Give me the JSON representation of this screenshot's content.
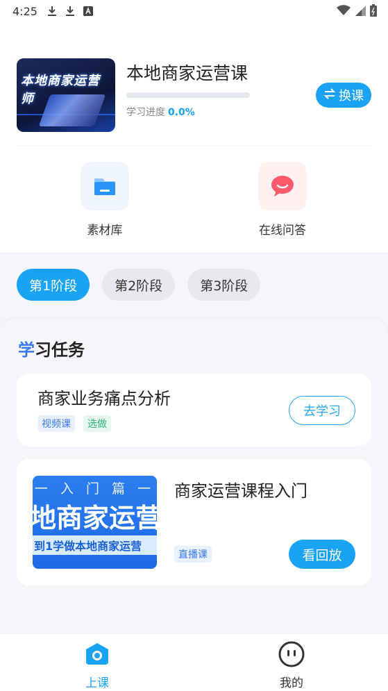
{
  "status_bar": {
    "time": "4:25",
    "icons": [
      "download-icon",
      "download-icon",
      "font-icon",
      "wifi-icon",
      "signal-icon",
      "battery-icon"
    ]
  },
  "course": {
    "thumbnail_text": "本地商家运营师",
    "title": "本地商家运营课",
    "progress_label": "学习进度",
    "progress_value_text": "0.0%",
    "progress_fraction": 0.0,
    "switch_label": "换课",
    "switch_icon": "swap-icon"
  },
  "features": [
    {
      "label": "素材库",
      "icon": "folder-icon",
      "color": "#2a93f5"
    },
    {
      "label": "在线问答",
      "icon": "chat-bubble-icon",
      "color": "#ff5a6a"
    }
  ],
  "stages": [
    {
      "label": "第1阶段",
      "active": true
    },
    {
      "label": "第2阶段",
      "active": false
    },
    {
      "label": "第3阶段",
      "active": false
    }
  ],
  "tasks_section": {
    "title_accent": "学",
    "title_rest": "习任务"
  },
  "tasks": [
    {
      "title": "商家业务痛点分析",
      "tags": [
        {
          "text": "视频课",
          "style": "blue"
        },
        {
          "text": "选做",
          "style": "green"
        }
      ],
      "action": "去学习"
    },
    {
      "title": "商家运营课程入门",
      "thumb_line1": "一 入 门 篇 一",
      "thumb_line2": "地商家运营",
      "thumb_line3": "到1学做本地商家运营",
      "tags": [
        {
          "text": "直播课",
          "style": "blue"
        }
      ],
      "action": "看回放"
    }
  ],
  "bottom_nav": [
    {
      "label": "上课",
      "icon": "class-home-icon",
      "active": true
    },
    {
      "label": "我的",
      "icon": "profile-face-icon",
      "active": false
    }
  ],
  "colors": {
    "accent": "#18a3f5",
    "title_accent": "#3a78f2",
    "tag_green": "#2bb673",
    "chat_red": "#ff5a6a"
  }
}
